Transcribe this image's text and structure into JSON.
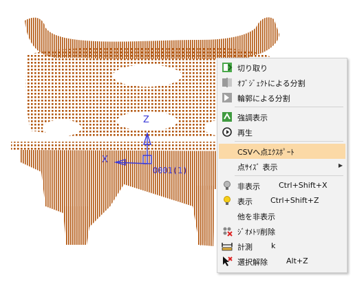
{
  "viewport": {
    "point_cloud_color": "#b0530b",
    "axis_color": "#3a3ad8",
    "axis_x_label": "X",
    "axis_z_label": "Z",
    "origin_label": "0001(1)"
  },
  "context_menu": {
    "highlight_color": "#fbd9a6",
    "items": [
      {
        "label": "切り取り",
        "shortcut": "",
        "icon": "cut-icon"
      },
      {
        "label": "ｵﾌﾞｼﾞｪｸﾄによる分割",
        "shortcut": "",
        "icon": "split-by-object-icon"
      },
      {
        "label": "輪郭による分割",
        "shortcut": "",
        "icon": "split-by-contour-icon"
      },
      {
        "label": "強調表示",
        "shortcut": "",
        "icon": "highlight-icon"
      },
      {
        "label": "再生",
        "shortcut": "",
        "icon": "replay-icon"
      },
      {
        "label": "CSVへ点ｴｸｽﾎﾟｰﾄ",
        "shortcut": "",
        "icon": ""
      },
      {
        "label": "点ｻｲｽﾞ 表示",
        "shortcut": "",
        "icon": ""
      },
      {
        "label": "非表示",
        "shortcut": "Ctrl+Shift+X",
        "icon": "lightbulb-off-icon"
      },
      {
        "label": "表示",
        "shortcut": "Ctrl+Shift+Z",
        "icon": "lightbulb-on-icon"
      },
      {
        "label": "他を非表示",
        "shortcut": "",
        "icon": ""
      },
      {
        "label": "ｼﾞｵﾒﾄﾘ削除",
        "shortcut": "",
        "icon": "delete-geometry-icon"
      },
      {
        "label": "計測",
        "shortcut": "k",
        "icon": "measure-icon"
      },
      {
        "label": "選択解除",
        "shortcut": "Alt+Z",
        "icon": "deselect-icon"
      }
    ]
  }
}
